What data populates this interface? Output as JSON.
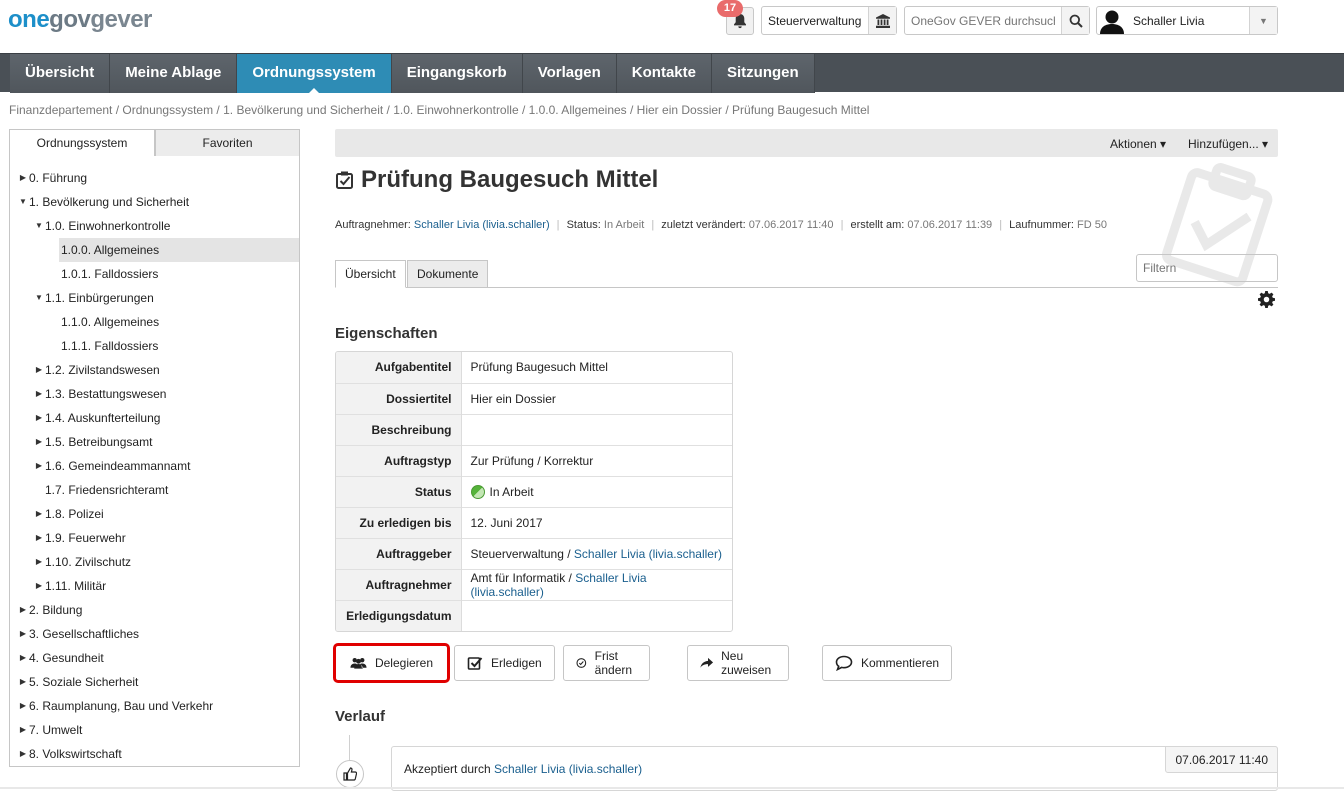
{
  "header": {
    "logo": {
      "part1": "one",
      "part2": "gov",
      "part3": "gever"
    },
    "notifications_count": "17",
    "org_unit": "Steuerverwaltung",
    "search_placeholder": "OneGov GEVER durchsuchen",
    "user_name": "Schaller Livia"
  },
  "nav": {
    "items": [
      "Übersicht",
      "Meine Ablage",
      "Ordnungssystem",
      "Eingangskorb",
      "Vorlagen",
      "Kontakte",
      "Sitzungen"
    ],
    "active": "Ordnungssystem"
  },
  "breadcrumb": "Finanzdepartement / Ordnungssystem / 1. Bevölkerung und Sicherheit / 1.0. Einwohnerkontrolle / 1.0.0. Allgemeines / Hier ein Dossier / Prüfung Baugesuch Mittel",
  "sidebar": {
    "tabs": [
      "Ordnungssystem",
      "Favoriten"
    ],
    "tree": [
      {
        "label": "0. Führung",
        "expander": "collapsed",
        "level": 0
      },
      {
        "label": "1. Bevölkerung und Sicherheit",
        "expander": "expanded",
        "level": 0
      },
      {
        "label": "1.0. Einwohnerkontrolle",
        "expander": "expanded",
        "level": 1
      },
      {
        "label": "1.0.0. Allgemeines",
        "expander": "none",
        "level": 2,
        "selected": true
      },
      {
        "label": "1.0.1. Falldossiers",
        "expander": "none",
        "level": 2
      },
      {
        "label": "1.1. Einbürgerungen",
        "expander": "expanded",
        "level": 1
      },
      {
        "label": "1.1.0. Allgemeines",
        "expander": "none",
        "level": 2
      },
      {
        "label": "1.1.1. Falldossiers",
        "expander": "none",
        "level": 2
      },
      {
        "label": "1.2. Zivilstandswesen",
        "expander": "collapsed",
        "level": 1
      },
      {
        "label": "1.3. Bestattungswesen",
        "expander": "collapsed",
        "level": 1
      },
      {
        "label": "1.4. Auskunfterteilung",
        "expander": "collapsed",
        "level": 1
      },
      {
        "label": "1.5. Betreibungsamt",
        "expander": "collapsed",
        "level": 1
      },
      {
        "label": "1.6. Gemeindeammannamt",
        "expander": "collapsed",
        "level": 1
      },
      {
        "label": "1.7. Friedensrichteramt",
        "expander": "none",
        "level": 1
      },
      {
        "label": "1.8. Polizei",
        "expander": "collapsed",
        "level": 1
      },
      {
        "label": "1.9. Feuerwehr",
        "expander": "collapsed",
        "level": 1
      },
      {
        "label": "1.10. Zivilschutz",
        "expander": "collapsed",
        "level": 1
      },
      {
        "label": "1.11. Militär",
        "expander": "collapsed",
        "level": 1
      },
      {
        "label": "2. Bildung",
        "expander": "collapsed",
        "level": 0
      },
      {
        "label": "3. Gesellschaftliches",
        "expander": "collapsed",
        "level": 0
      },
      {
        "label": "4. Gesundheit",
        "expander": "collapsed",
        "level": 0
      },
      {
        "label": "5. Soziale Sicherheit",
        "expander": "collapsed",
        "level": 0
      },
      {
        "label": "6. Raumplanung, Bau und Verkehr",
        "expander": "collapsed",
        "level": 0
      },
      {
        "label": "7. Umwelt",
        "expander": "collapsed",
        "level": 0
      },
      {
        "label": "8. Volkswirtschaft",
        "expander": "collapsed",
        "level": 0
      }
    ]
  },
  "actions": {
    "aktionen": "Aktionen ▾",
    "hinzufuegen": "Hinzufügen... ▾"
  },
  "task": {
    "title": "Prüfung Baugesuch Mittel",
    "meta": {
      "assignee_label": "Auftragnehmer:",
      "assignee": "Schaller Livia (livia.schaller)",
      "status_label": "Status:",
      "status": "In Arbeit",
      "modified_label": "zuletzt verändert:",
      "modified": "07.06.2017 11:40",
      "created_label": "erstellt am:",
      "created": "07.06.2017 11:39",
      "seq_label": "Laufnummer:",
      "seq": "FD 50"
    }
  },
  "tabs": [
    "Übersicht",
    "Dokumente"
  ],
  "filter_placeholder": "Filtern",
  "properties": {
    "heading": "Eigenschaften",
    "rows": [
      {
        "key": "Aufgabentitel",
        "value": "Prüfung Baugesuch Mittel"
      },
      {
        "key": "Dossiertitel",
        "value": "Hier ein Dossier"
      },
      {
        "key": "Beschreibung",
        "value": ""
      },
      {
        "key": "Auftragstyp",
        "value": "Zur Prüfung / Korrektur"
      },
      {
        "key": "Status",
        "value": "In Arbeit"
      },
      {
        "key": "Zu erledigen bis",
        "value": "12. Juni 2017"
      },
      {
        "key": "Auftraggeber",
        "value": "Steuerverwaltung / ",
        "link": "Schaller Livia (livia.schaller)"
      },
      {
        "key": "Auftragnehmer",
        "value": "Amt für Informatik / ",
        "link": "Schaller Livia (livia.schaller)"
      },
      {
        "key": "Erledigungsdatum",
        "value": ""
      }
    ]
  },
  "buttons": [
    "Delegieren",
    "Erledigen",
    "Frist ändern",
    "Neu zuweisen",
    "Kommentieren"
  ],
  "history": {
    "heading": "Verlauf",
    "entry_text": "Akzeptiert durch ",
    "entry_link": "Schaller Livia (livia.schaller)",
    "entry_date": "07.06.2017 11:40"
  },
  "colors": {
    "nav_bg": "#4a5056",
    "nav_active": "#2e8cb5",
    "link": "#1a5f8e",
    "highlight": "#e00000",
    "badge": "#e96b6b"
  }
}
